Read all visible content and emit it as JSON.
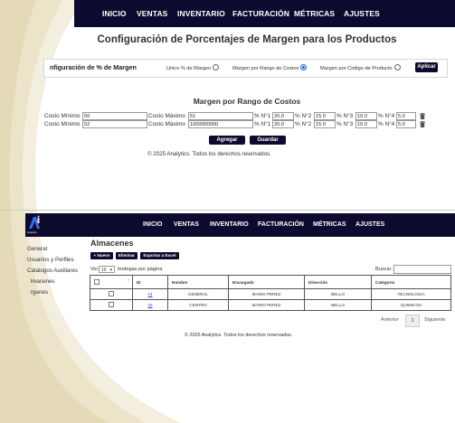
{
  "nav_top": {
    "items": [
      "INICIO",
      "VENTAS",
      "INVENTARIO",
      "FACTURACIÓN",
      "MÉTRICAS",
      "AJUSTES"
    ]
  },
  "config": {
    "title": "Configuración de Porcentajes de Margen para los Productos",
    "bar_label": "nfiguración de % de Margen",
    "options": [
      "Unico % de Margen",
      "Margen por Rango de Costos",
      "Margen por Codigo de Producto"
    ],
    "selected_option": "Margen por Rango de Costos",
    "apply_label": "Aplicar",
    "subtitle": "Margen por Rango de Costos",
    "label_min": "Costo Mínimo",
    "label_max": "Costo Máximo",
    "pct_labels": [
      "% N°1",
      "% N°2",
      "% N°3",
      "% N°4"
    ],
    "rows": [
      {
        "min": "50",
        "max": "51",
        "pcts": [
          "20.0",
          "15.0",
          "10.0",
          "5.0"
        ]
      },
      {
        "min": "52",
        "max": "1000000000",
        "pcts": [
          "20.0",
          "15.0",
          "10.0",
          "5.0"
        ]
      }
    ],
    "add_label": "Agregar",
    "save_label": "Guardar",
    "copyright": "© 2025 Analytics. Todos los derechos reservados."
  },
  "nav_bottom": {
    "items": [
      "INICIO",
      "VENTAS",
      "INVENTARIO",
      "FACTURACIÓN",
      "MÉTRICAS",
      "AJUSTES"
    ],
    "logo_text": "Analytics"
  },
  "sidebar": {
    "items": [
      "General",
      "Usuarios y Perfiles",
      "Catalogos Auxiliares",
      "lmacenes",
      "rgenes"
    ]
  },
  "warehouses": {
    "title": "Almacenes",
    "buttons": [
      "+ Nuevo",
      "Eliminar",
      "Exportar a Excel"
    ],
    "show_prefix": "Ver",
    "page_size": "10",
    "show_suffix": "bodegas por página",
    "search_label": "Buscar:",
    "columns": [
      "",
      "ID",
      "Nombre",
      "Encargado",
      "Dirección",
      "Categoría"
    ],
    "rows": [
      {
        "id": "14",
        "name": "GENERAL",
        "manager": "MARIO PEREZ",
        "address": "BELLO",
        "category": "TECNOLOGIA"
      },
      {
        "id": "15",
        "name": "CENTRO",
        "manager": "MARIO PEREZ",
        "address": "BELLO",
        "category": "QUIMICOS"
      }
    ],
    "prev_label": "Anterior",
    "page": "1",
    "next_label": "Siguiente",
    "copyright": "© 2025 Analytics. Todos los derechos reservados."
  },
  "colors": {
    "nav_bg": "#0c0a2e",
    "link": "#1a3bd6",
    "accent_curve": "#eee6cf"
  }
}
